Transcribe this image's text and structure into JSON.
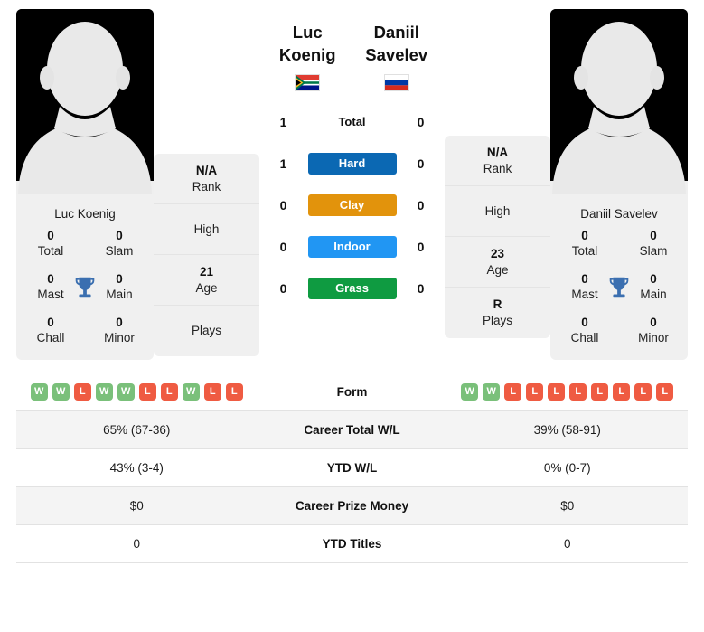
{
  "players": {
    "left": {
      "name": "Luc Koenig",
      "flag": "south-africa",
      "avatar_alt": "player-silhouette",
      "titles_card_name": "Luc Koenig",
      "titles": [
        {
          "label": "Total",
          "value": "0"
        },
        {
          "label": "Slam",
          "value": "0"
        },
        {
          "label": "Mast",
          "value": "0"
        },
        {
          "label": "Main",
          "value": "0"
        },
        {
          "label": "Chall",
          "value": "0"
        },
        {
          "label": "Minor",
          "value": "0"
        }
      ],
      "info": [
        {
          "label": "Rank",
          "value": "N/A"
        },
        {
          "label": "High",
          "value": ""
        },
        {
          "label": "Age",
          "value": "21"
        },
        {
          "label": "Plays",
          "value": ""
        }
      ],
      "form": [
        "W",
        "W",
        "L",
        "W",
        "W",
        "L",
        "L",
        "W",
        "L",
        "L"
      ],
      "stats": {
        "career_total_wl": "65% (67-36)",
        "ytd_wl": "43% (3-4)",
        "career_prize_money": "$0",
        "ytd_titles": "0"
      }
    },
    "right": {
      "name": "Daniil Savelev",
      "flag": "russia",
      "avatar_alt": "player-silhouette",
      "titles_card_name": "Daniil Savelev",
      "titles": [
        {
          "label": "Total",
          "value": "0"
        },
        {
          "label": "Slam",
          "value": "0"
        },
        {
          "label": "Mast",
          "value": "0"
        },
        {
          "label": "Main",
          "value": "0"
        },
        {
          "label": "Chall",
          "value": "0"
        },
        {
          "label": "Minor",
          "value": "0"
        }
      ],
      "info": [
        {
          "label": "Rank",
          "value": "N/A"
        },
        {
          "label": "High",
          "value": ""
        },
        {
          "label": "Age",
          "value": "23"
        },
        {
          "label": "Plays",
          "value": "R"
        }
      ],
      "form": [
        "W",
        "W",
        "L",
        "L",
        "L",
        "L",
        "L",
        "L",
        "L",
        "L"
      ],
      "stats": {
        "career_total_wl": "39% (58-91)",
        "ytd_wl": "0% (0-7)",
        "career_prize_money": "$0",
        "ytd_titles": "0"
      }
    }
  },
  "surfaces": [
    {
      "label": "Total",
      "left": "1",
      "right": "0",
      "color": "",
      "plain": true
    },
    {
      "label": "Hard",
      "left": "1",
      "right": "0",
      "color": "#0b68b3",
      "plain": false
    },
    {
      "label": "Clay",
      "left": "0",
      "right": "0",
      "color": "#e2930c",
      "plain": false
    },
    {
      "label": "Indoor",
      "left": "0",
      "right": "0",
      "color": "#2196f3",
      "plain": false
    },
    {
      "label": "Grass",
      "left": "0",
      "right": "0",
      "color": "#0f9b41",
      "plain": false
    }
  ],
  "stats_rows": [
    {
      "label": "Form",
      "key": "form",
      "type": "form",
      "alt": false
    },
    {
      "label": "Career Total W/L",
      "key": "career_total_wl",
      "type": "text",
      "alt": true
    },
    {
      "label": "YTD W/L",
      "key": "ytd_wl",
      "type": "text",
      "alt": false
    },
    {
      "label": "Career Prize Money",
      "key": "career_prize_money",
      "type": "text",
      "alt": true
    },
    {
      "label": "YTD Titles",
      "key": "ytd_titles",
      "type": "text",
      "alt": false
    }
  ],
  "colors": {
    "hard": "#0b68b3",
    "clay": "#e2930c",
    "indoor": "#2196f3",
    "grass": "#0f9b41",
    "win": "#7ac07a",
    "loss": "#ef5b42",
    "trophy": "#3b6fb0",
    "card_bg": "#f0f0f0"
  }
}
